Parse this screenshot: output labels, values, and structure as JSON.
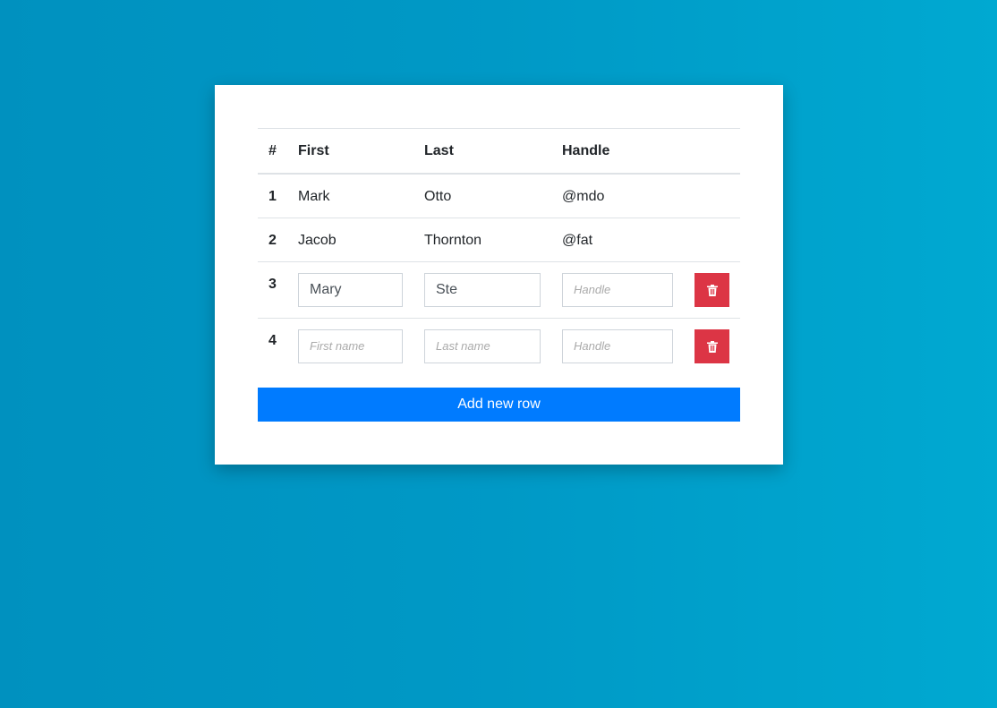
{
  "table": {
    "headers": [
      "#",
      "First",
      "Last",
      "Handle"
    ],
    "rows": [
      {
        "num": "1",
        "first": "Mark",
        "last": "Otto",
        "handle": "@mdo"
      },
      {
        "num": "2",
        "first": "Jacob",
        "last": "Thornton",
        "handle": "@fat"
      }
    ],
    "edit_rows": [
      {
        "num": "3",
        "first": "Mary",
        "last": "Ste",
        "handle": ""
      },
      {
        "num": "4",
        "first": "",
        "last": "",
        "handle": ""
      }
    ],
    "placeholders": {
      "first": "First name",
      "last": "Last name",
      "handle": "Handle"
    }
  },
  "add_button": "Add new row",
  "colors": {
    "delete": "#dc3545",
    "primary": "#007bff"
  },
  "icons": {
    "delete": "trash-icon"
  }
}
